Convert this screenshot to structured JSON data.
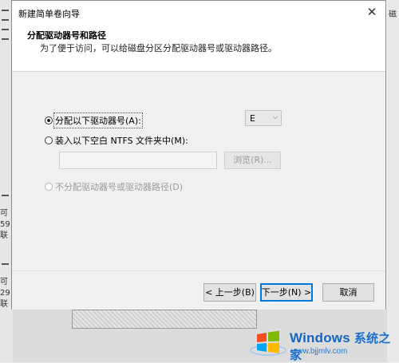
{
  "background": {
    "left_fragments": [
      "可",
      "59",
      "联",
      "可",
      "29",
      "联"
    ],
    "right_fragment": "磁"
  },
  "dialog": {
    "title": "新建简单卷向导",
    "close_glyph": "✕",
    "header_title": "分配驱动器号和路径",
    "header_subtitle": "为了便于访问，可以给磁盘分区分配驱动器号或驱动器路径。",
    "options": {
      "assign_letter": {
        "label": "分配以下驱动器号(A):",
        "selected": true
      },
      "mount_folder": {
        "label": "装入以下空白 NTFS 文件夹中(M):",
        "selected": false
      },
      "no_assign": {
        "label": "不分配驱动器号或驱动器路径(D)",
        "disabled": true
      }
    },
    "drive_letter": {
      "value": "E",
      "chevron": "⌵"
    },
    "folder_path": {
      "value": ""
    },
    "browse_label": "浏览(R)...",
    "buttons": {
      "back": "< 上一步(B)",
      "next": "下一步(N) >",
      "cancel": "取消"
    }
  },
  "watermark": {
    "brand": "Windows",
    "brand_cn": "系统之家",
    "url": "www.bjjmlv.com"
  },
  "colors": {
    "primary_border": "#0078d7",
    "logo_red": "#f25022",
    "logo_green": "#7fba00",
    "logo_blue": "#00a4ef",
    "logo_yellow": "#ffb900"
  }
}
